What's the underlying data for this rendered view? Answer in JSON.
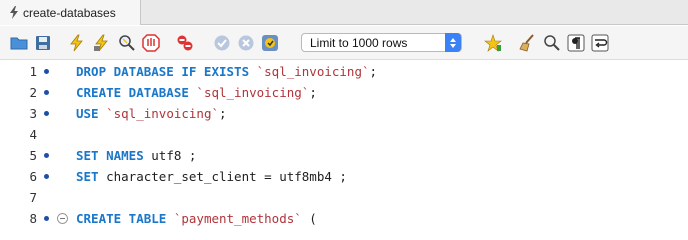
{
  "tab": {
    "title": "create-databases"
  },
  "toolbar": {
    "limit_select": "Limit to 1000 rows",
    "icons": [
      "open-folder-icon",
      "save-icon",
      "execute-icon",
      "execute-current-icon",
      "explain-icon",
      "stop-icon",
      "toggle-continue-on-error-icon",
      "commit-icon",
      "rollback-icon",
      "autocommit-icon",
      "favorite-snippet-icon",
      "beautify-icon",
      "find-icon",
      "invisible-characters-icon",
      "word-wrap-icon"
    ]
  },
  "editor": {
    "lines": [
      {
        "number": "1",
        "tokens": [
          {
            "t": "DROP DATABASE IF EXISTS ",
            "c": "kw"
          },
          {
            "t": "`sql_invoicing`",
            "c": "str"
          },
          {
            "t": ";",
            "c": ""
          }
        ]
      },
      {
        "number": "2",
        "tokens": [
          {
            "t": "CREATE DATABASE ",
            "c": "kw"
          },
          {
            "t": "`sql_invoicing`",
            "c": "str"
          },
          {
            "t": ";",
            "c": ""
          }
        ]
      },
      {
        "number": "3",
        "tokens": [
          {
            "t": "USE ",
            "c": "kw"
          },
          {
            "t": "`sql_invoicing`",
            "c": "str"
          },
          {
            "t": ";",
            "c": ""
          }
        ]
      },
      {
        "number": "4",
        "tokens": []
      },
      {
        "number": "5",
        "tokens": [
          {
            "t": "SET NAMES ",
            "c": "kw"
          },
          {
            "t": "utf8 ;",
            "c": ""
          }
        ]
      },
      {
        "number": "6",
        "tokens": [
          {
            "t": "SET ",
            "c": "kw"
          },
          {
            "t": "character_set_client = utf8mb4 ;",
            "c": ""
          }
        ]
      },
      {
        "number": "7",
        "tokens": []
      },
      {
        "number": "8",
        "tokens": [
          {
            "t": "CREATE TABLE ",
            "c": "kw"
          },
          {
            "t": "`payment_methods`",
            "c": "str"
          },
          {
            "t": " (",
            "c": ""
          }
        ]
      }
    ]
  }
}
